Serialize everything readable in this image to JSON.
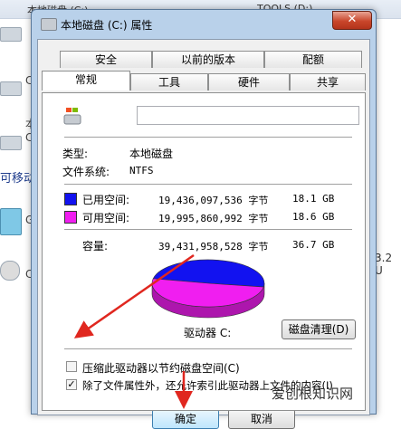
{
  "background_window": {
    "header_left": "本地磁盘 (C:)",
    "header_right": "TOOLS (D:)",
    "side_labels": [
      "C",
      "本",
      "C",
      "G",
      "C"
    ],
    "section_label": "可移动",
    "right_text": "3.2 U"
  },
  "dialog": {
    "title": "本地磁盘 (C:) 属性",
    "close_label": "✕",
    "tabs_top": [
      "安全",
      "以前的版本",
      "配额"
    ],
    "tabs_bottom": [
      "常规",
      "工具",
      "硬件",
      "共享"
    ],
    "active_tab": "常规",
    "name_value": "",
    "type_label": "类型:",
    "type_value": "本地磁盘",
    "fs_label": "文件系统:",
    "fs_value": "NTFS",
    "used": {
      "label": "已用空间:",
      "bytes": "19,436,097,536 字节",
      "size": "18.1 GB",
      "color": "#1212f0"
    },
    "free": {
      "label": "可用空间:",
      "bytes": "19,995,860,992 字节",
      "size": "18.6 GB",
      "color": "#f01ef0"
    },
    "capacity": {
      "label": "容量:",
      "bytes": "39,431,958,528 字节",
      "size": "36.7 GB"
    },
    "drive_label": "驱动器 C:",
    "cleanup_button": "磁盘清理(D)",
    "compress_checkbox": {
      "label": "压缩此驱动器以节约磁盘空间(C)",
      "checked": false
    },
    "index_checkbox": {
      "label": "除了文件属性外，还允许索引此驱动器上文件的内容(I)",
      "checked": true
    },
    "ok_button": "确定",
    "cancel_button": "取消"
  },
  "chart_data": {
    "type": "pie",
    "categories": [
      "已用空间",
      "可用空间"
    ],
    "values": [
      19436097536,
      19995860992
    ],
    "colors": [
      "#1212f0",
      "#f01ef0"
    ]
  },
  "annotation_color": "#e0271f",
  "watermark": "爱创根知识网"
}
